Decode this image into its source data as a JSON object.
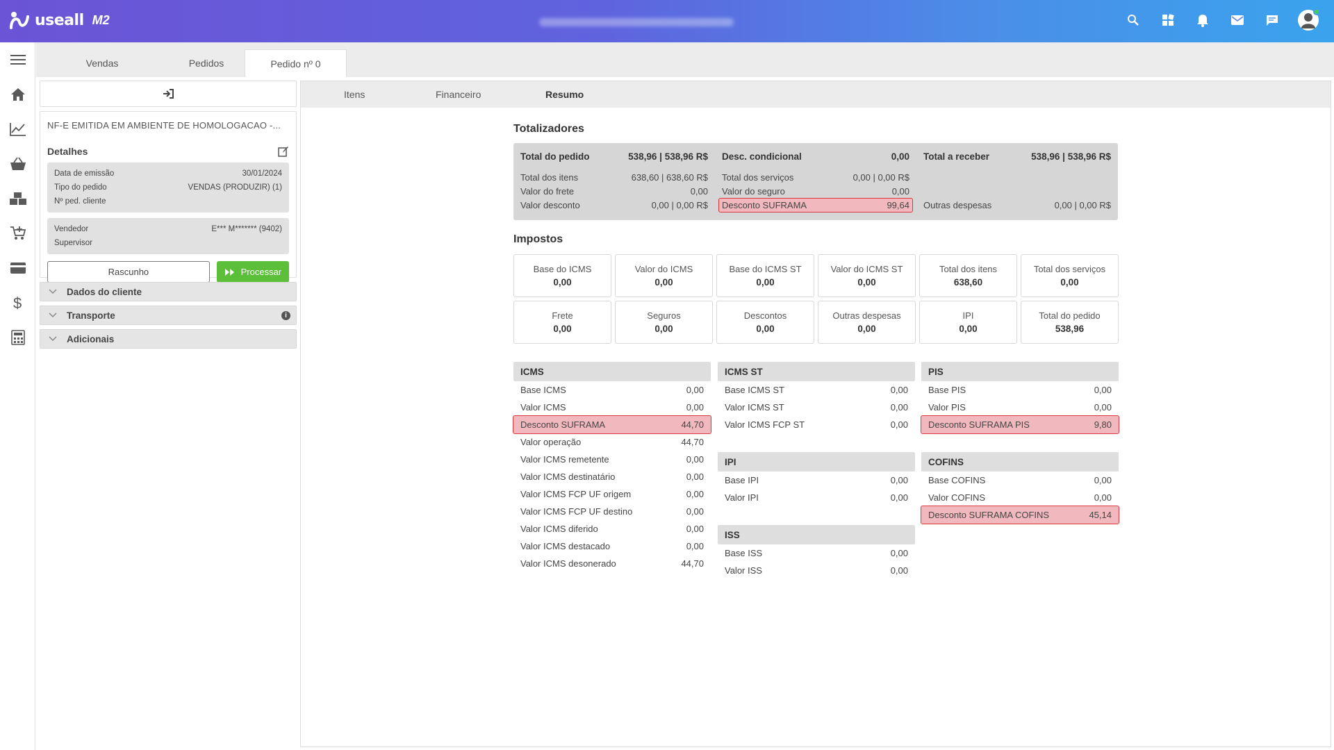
{
  "app": {
    "brand": "useall",
    "version": "M2"
  },
  "header_icons": [
    "search-icon",
    "apps-icon",
    "bell-icon",
    "mail-icon",
    "chat-icon",
    "user-avatar-icon"
  ],
  "sidebar_icons": [
    "menu-icon",
    "home-icon",
    "chart-line-icon",
    "basket-icon",
    "boxes-icon",
    "cart-add-icon",
    "credit-card-icon",
    "dollar-icon",
    "calculator-icon"
  ],
  "tabs": [
    {
      "label": "Vendas"
    },
    {
      "label": "Pedidos"
    },
    {
      "label": "Pedido nº 0"
    }
  ],
  "left": {
    "title": "NF-E EMITIDA EM AMBIENTE DE HOMOLOGACAO -...",
    "details_label": "Detalhes",
    "details": [
      {
        "label": "Data de emissão",
        "value": "30/01/2024"
      },
      {
        "label": "Tipo do pedido",
        "value": "VENDAS (PRODUZIR) (1)"
      },
      {
        "label": "Nº ped. cliente",
        "value": ""
      }
    ],
    "people": [
      {
        "label": "Vendedor",
        "value": "E*** M******* (9402)"
      },
      {
        "label": "Supervisor",
        "value": ""
      }
    ],
    "btn_draft": "Rascunho",
    "btn_process": "Processar",
    "accordions": [
      {
        "label": "Dados do cliente"
      },
      {
        "label": "Transporte"
      },
      {
        "label": "Adicionais"
      }
    ]
  },
  "subtabs": [
    {
      "label": "Itens"
    },
    {
      "label": "Financeiro"
    },
    {
      "label": "Resumo"
    }
  ],
  "totalizadores": {
    "title": "Totalizadores",
    "col1": [
      {
        "label": "Total do pedido",
        "value": "538,96  |  538,96 R$"
      },
      {
        "label": "Total dos itens",
        "value": "638,60  |  638,60 R$"
      },
      {
        "label": "Valor do frete",
        "value": "0,00"
      },
      {
        "label": "Valor desconto",
        "value": "0,00  |  0,00 R$"
      }
    ],
    "col2": [
      {
        "label": "Desc. condicional",
        "value": "0,00"
      },
      {
        "label": "Total dos serviços",
        "value": "0,00  |  0,00 R$"
      },
      {
        "label": "Valor do seguro",
        "value": "0,00"
      },
      {
        "label": "Desconto SUFRAMA",
        "value": "99,64"
      }
    ],
    "col3": [
      {
        "label": "Total a receber",
        "value": "538,96  |  538,96 R$"
      },
      {
        "label": "Outras despesas",
        "value": "0,00  |  0,00 R$"
      }
    ]
  },
  "impostos": {
    "title": "Impostos",
    "cards": [
      {
        "label": "Base do ICMS",
        "value": "0,00"
      },
      {
        "label": "Valor do ICMS",
        "value": "0,00"
      },
      {
        "label": "Base do ICMS ST",
        "value": "0,00"
      },
      {
        "label": "Valor do ICMS ST",
        "value": "0,00"
      },
      {
        "label": "Total dos itens",
        "value": "638,60"
      },
      {
        "label": "Total dos serviços",
        "value": "0,00"
      },
      {
        "label": "Frete",
        "value": "0,00"
      },
      {
        "label": "Seguros",
        "value": "0,00"
      },
      {
        "label": "Descontos",
        "value": "0,00"
      },
      {
        "label": "Outras despesas",
        "value": "0,00"
      },
      {
        "label": "IPI",
        "value": "0,00"
      },
      {
        "label": "Total do pedido",
        "value": "538,96"
      }
    ]
  },
  "groups": {
    "icms": {
      "title": "ICMS",
      "rows": [
        {
          "label": "Base ICMS",
          "value": "0,00"
        },
        {
          "label": "Valor ICMS",
          "value": "0,00"
        },
        {
          "label": "Desconto SUFRAMA",
          "value": "44,70"
        },
        {
          "label": "Valor operação",
          "value": "44,70"
        },
        {
          "label": "Valor ICMS remetente",
          "value": "0,00"
        },
        {
          "label": "Valor ICMS destinatário",
          "value": "0,00"
        },
        {
          "label": "Valor ICMS FCP UF origem",
          "value": "0,00"
        },
        {
          "label": "Valor ICMS FCP UF destino",
          "value": "0,00"
        },
        {
          "label": "Valor ICMS diferido",
          "value": "0,00"
        },
        {
          "label": "Valor ICMS destacado",
          "value": "0,00"
        },
        {
          "label": "Valor ICMS desonerado",
          "value": "44,70"
        }
      ]
    },
    "icmsst": {
      "title": "ICMS ST",
      "rows": [
        {
          "label": "Base ICMS ST",
          "value": "0,00"
        },
        {
          "label": "Valor ICMS ST",
          "value": "0,00"
        },
        {
          "label": "Valor ICMS FCP ST",
          "value": "0,00"
        }
      ]
    },
    "ipi": {
      "title": "IPI",
      "rows": [
        {
          "label": "Base IPI",
          "value": "0,00"
        },
        {
          "label": "Valor IPI",
          "value": "0,00"
        }
      ]
    },
    "iss": {
      "title": "ISS",
      "rows": [
        {
          "label": "Base ISS",
          "value": "0,00"
        },
        {
          "label": "Valor ISS",
          "value": "0,00"
        }
      ]
    },
    "pis": {
      "title": "PIS",
      "rows": [
        {
          "label": "Base PIS",
          "value": "0,00"
        },
        {
          "label": "Valor PIS",
          "value": "0,00"
        },
        {
          "label": "Desconto SUFRAMA PIS",
          "value": "9,80"
        }
      ]
    },
    "cofins": {
      "title": "COFINS",
      "rows": [
        {
          "label": "Base COFINS",
          "value": "0,00"
        },
        {
          "label": "Valor COFINS",
          "value": "0,00"
        },
        {
          "label": "Desconto SUFRAMA COFINS",
          "value": "45,14"
        }
      ]
    }
  },
  "colors": {
    "highlight_border": "#d9363e",
    "highlight_fill": "#f1b9bd",
    "process_button": "#5bbf3a"
  }
}
